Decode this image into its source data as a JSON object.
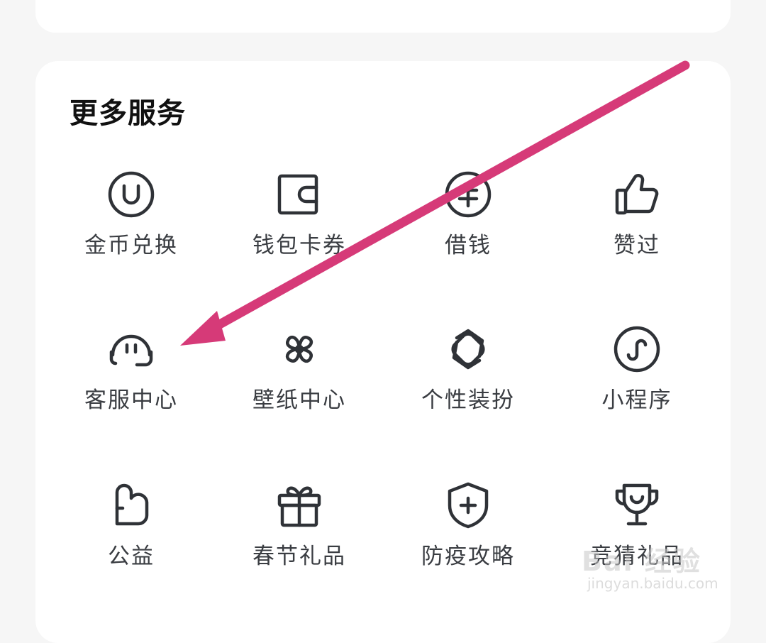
{
  "section": {
    "title": "更多服务"
  },
  "services": [
    {
      "label": "金币兑换",
      "icon": "coin-icon"
    },
    {
      "label": "钱包卡券",
      "icon": "wallet-icon"
    },
    {
      "label": "借钱",
      "icon": "loan-icon"
    },
    {
      "label": "赞过",
      "icon": "thumbs-up-icon"
    },
    {
      "label": "客服中心",
      "icon": "headset-icon"
    },
    {
      "label": "壁纸中心",
      "icon": "pinwheel-icon"
    },
    {
      "label": "个性装扮",
      "icon": "interlock-icon"
    },
    {
      "label": "小程序",
      "icon": "mini-program-icon"
    },
    {
      "label": "公益",
      "icon": "charity-icon"
    },
    {
      "label": "春节礼品",
      "icon": "gift-icon"
    },
    {
      "label": "防疫攻略",
      "icon": "shield-plus-icon"
    },
    {
      "label": "竞猜礼品",
      "icon": "trophy-icon"
    }
  ],
  "annotation": {
    "arrow_color": "#d63a78"
  },
  "watermark": {
    "logo": "Bai 经验",
    "url": "jingyan.baidu.com"
  },
  "colors": {
    "background": "#f6f6f6",
    "card": "#ffffff",
    "text": "#3a3d42",
    "icon": "#2f3237"
  }
}
